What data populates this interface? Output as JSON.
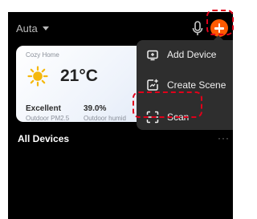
{
  "header": {
    "home_name": "Auta"
  },
  "weather": {
    "home_label": "Cozy Home",
    "temperature": "21°C",
    "air_quality_value": "Excellent",
    "air_quality_label": "Outdoor PM2.5",
    "humidity_value": "39.0%",
    "humidity_label": "Outdoor humid"
  },
  "devices": {
    "title": "All Devices",
    "more": "···"
  },
  "menu": {
    "items": [
      {
        "label": "Add Device",
        "icon": "add-device-icon"
      },
      {
        "label": "Create Scene",
        "icon": "create-scene-icon"
      },
      {
        "label": "Scan",
        "icon": "scan-icon"
      }
    ]
  },
  "colors": {
    "accent": "#ff5a00",
    "highlight": "#e0001a",
    "menu_bg": "#2e2e2e"
  }
}
